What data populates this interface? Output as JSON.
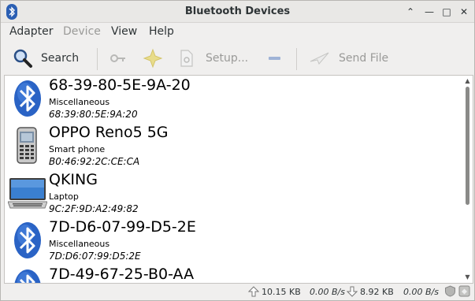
{
  "window": {
    "title": "Bluetooth Devices"
  },
  "menubar": {
    "adapter": "Adapter",
    "device": "Device",
    "view": "View",
    "help": "Help"
  },
  "toolbar": {
    "search_label": "Search",
    "setup_label": "Setup...",
    "send_file_label": "Send File"
  },
  "devices": [
    {
      "name": "68-39-80-5E-9A-20",
      "type": "Miscellaneous",
      "address": "68:39:80:5E:9A:20",
      "icon": "bluetooth-icon"
    },
    {
      "name": "OPPO Reno5 5G",
      "type": "Smart phone",
      "address": "B0:46:92:2C:CE:CA",
      "icon": "phone-icon"
    },
    {
      "name": "QKING",
      "type": "Laptop",
      "address": "9C:2F:9D:A2:49:82",
      "icon": "laptop-icon"
    },
    {
      "name": "7D-D6-07-99-D5-2E",
      "type": "Miscellaneous",
      "address": "7D:D6:07:99:D5:2E",
      "icon": "bluetooth-icon"
    },
    {
      "name": "7D-49-67-25-B0-AA",
      "type": "",
      "address": "",
      "icon": "bluetooth-icon"
    }
  ],
  "status": {
    "upload_total": "10.15 KB",
    "upload_rate": "0.00 B/s",
    "download_total": "8.92 KB",
    "download_rate": "0.00 B/s"
  }
}
